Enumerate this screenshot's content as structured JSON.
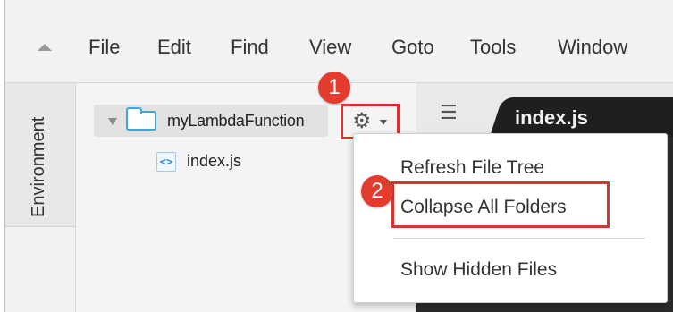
{
  "menubar": {
    "items": [
      "File",
      "Edit",
      "Find",
      "View",
      "Goto",
      "Tools",
      "Window"
    ]
  },
  "sidebar": {
    "tab_label": "Environment"
  },
  "tree": {
    "root_label": "myLambdaFunction",
    "file_label": "index.js",
    "file_icon_glyph": "<>"
  },
  "editor": {
    "tab_label": "index.js"
  },
  "dropdown": {
    "items": [
      "Refresh File Tree",
      "Collapse All Folders",
      "Show Hidden Files"
    ]
  },
  "badges": [
    "1",
    "2"
  ],
  "colors": {
    "annotation_red": "#e03131",
    "folder_blue": "#3fa7d6",
    "editor_dark": "#2b2b2b"
  },
  "icons": {
    "gear": "gear-icon",
    "folder": "folder-icon",
    "file": "js-file-icon",
    "tabs": "tab-list-icon"
  }
}
